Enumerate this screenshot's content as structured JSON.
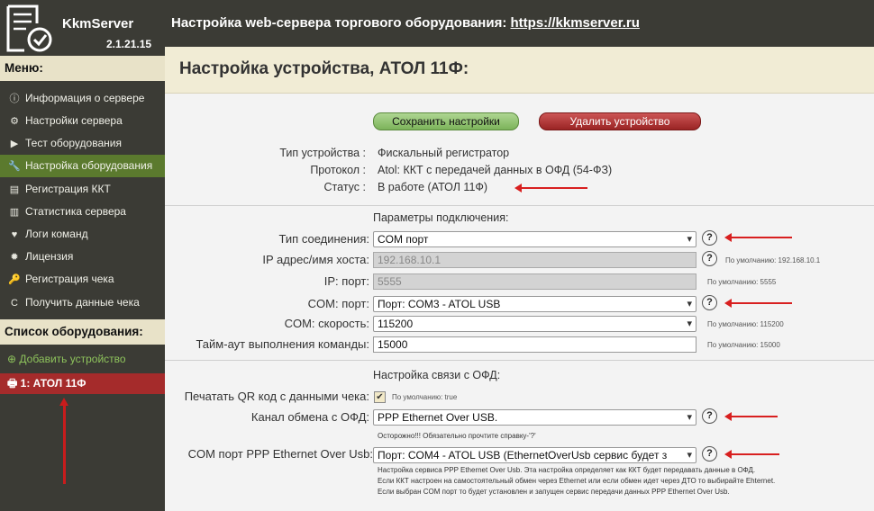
{
  "app": {
    "name": "KkmServer",
    "version": "2.1.21.15"
  },
  "topbar": {
    "title": "Настройка web-сервера торгового оборудования: ",
    "link": "https://kkmserver.ru"
  },
  "menu": {
    "heading": "Меню:",
    "items": [
      {
        "label": "Информация о сервере",
        "icon": "ⓘ"
      },
      {
        "label": "Настройки сервера",
        "icon": "⚙"
      },
      {
        "label": "Тест оборудования",
        "icon": "▶"
      },
      {
        "label": "Настройка оборудования",
        "icon": "🔧"
      },
      {
        "label": "Регистрация ККТ",
        "icon": "▤"
      },
      {
        "label": "Статистика сервера",
        "icon": "▥"
      },
      {
        "label": "Логи команд",
        "icon": "♥"
      },
      {
        "label": "Лицензия",
        "icon": "✹"
      },
      {
        "label": "Регистрация чека",
        "icon": "🔑"
      },
      {
        "label": "Получить данные чека",
        "icon": "C"
      }
    ]
  },
  "equipment": {
    "heading": "Список оборудования:",
    "add_label": "Добавить устройство",
    "device_label": "1: АТОЛ 11Ф"
  },
  "page": {
    "title": "Настройка устройства, АТОЛ 11Ф:"
  },
  "buttons": {
    "save": "Сохранить настройки",
    "delete": "Удалить устройство"
  },
  "info": {
    "type_label": "Тип устройства :",
    "type_value": "Фискальный регистратор",
    "protocol_label": "Протокол :",
    "protocol_value": "Atol: ККТ с передачей данных в ОФД (54-ФЗ)",
    "status_label": "Статус :",
    "status_value": "В работе (АТОЛ 11Ф)"
  },
  "connection": {
    "heading": "Параметры подключения:",
    "conn_type_label": "Тип соединения:",
    "conn_type_value": "COM порт",
    "ip_label": "IP адрес/имя хоста:",
    "ip_value": "192.168.10.1",
    "ip_default": "По умолчанию: 192.168.10.1",
    "port_label": "IP: порт:",
    "port_value": "5555",
    "port_default": "По умолчанию: 5555",
    "com_label": "COM: порт:",
    "com_value": "Порт: COM3 - ATOL USB",
    "speed_label": "COM: скорость:",
    "speed_value": "115200",
    "speed_default": "По умолчанию: 115200",
    "timeout_label": "Тайм-аут выполнения команды:",
    "timeout_value": "15000",
    "timeout_default": "По умолчанию: 15000"
  },
  "ofd": {
    "heading": "Настройка связи с ОФД:",
    "qr_label": "Печатать QR код с данными чека:",
    "qr_checked": "✔",
    "qr_default": "По умолчанию: true",
    "channel_label": "Канал обмена с ОФД:",
    "channel_value": "PPP Ethernet Over USB.",
    "warning": "Осторожно!!! Обязательно прочтите справку-'?'",
    "ppp_label": "COM порт PPP Ethernet Over Usb:",
    "ppp_value": "Порт: COM4 - ATOL USB (EthernetOverUsb сервис будет з",
    "note1": "Настройка сервиса PPP Ethernet Over Usb. Эта настройка определяет как ККТ будет передавать данные в ОФД.",
    "note2": "Если ККТ настроен на самостоятельный обмен через Ethernet или если обмен идет через ДТО то выбирайте Ehternet.",
    "note3": "Если выбран COM порт то будет установлен и запущен сервис передачи данных PPP Ethernet Over Usb."
  },
  "help_glyph": "?",
  "colors": {
    "sidebar": "#3b3b35",
    "active": "#5b7a2e",
    "device": "#a52b2b",
    "arrow": "#d81f1f"
  }
}
